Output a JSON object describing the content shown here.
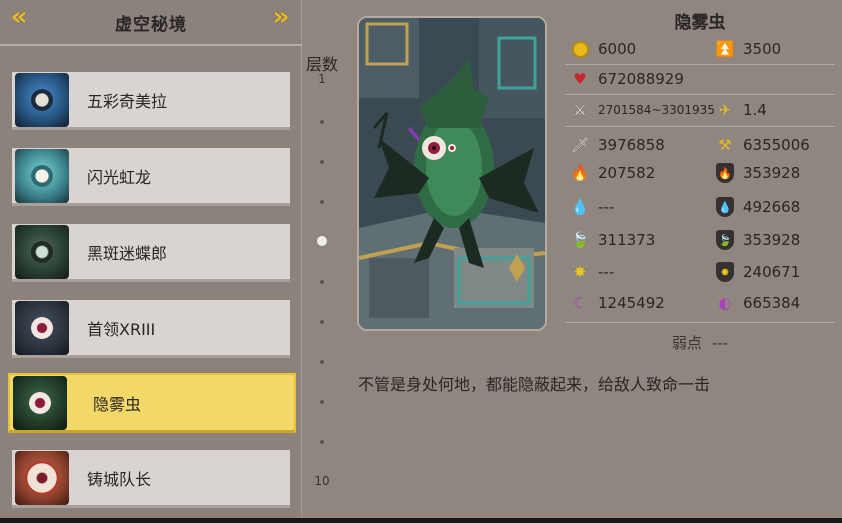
{
  "header": {
    "title": "虚空秘境",
    "prev_icon": "double-chevron-left-icon",
    "next_icon": "double-chevron-right-icon"
  },
  "monster_list": [
    {
      "name": "五彩奇美拉",
      "selected": false
    },
    {
      "name": "闪光虹龙",
      "selected": false
    },
    {
      "name": "黑斑迷蝶郎",
      "selected": false
    },
    {
      "name": "首领XRIII",
      "selected": false
    },
    {
      "name": "隐雾虫",
      "selected": true
    },
    {
      "name": "铸城队长",
      "selected": false
    }
  ],
  "floor": {
    "label": "层数",
    "first": "1",
    "last": "10",
    "current": 5
  },
  "monster": {
    "name": "隐雾虫",
    "gold": "6000",
    "exp": "3500",
    "hp": "672088929",
    "attack_range": "2701584~3301935",
    "attack_speed": "1.4",
    "physical_attack": "3976858",
    "physical_defense": "6355006",
    "fire_attack": "207582",
    "fire_defense": "353928",
    "water_attack": "---",
    "water_defense": "492668",
    "wood_attack": "311373",
    "wood_defense": "353928",
    "light_attack": "---",
    "light_defense": "240671",
    "dark_attack": "1245492",
    "dark_defense": "665384",
    "weakness_label": "弱点",
    "weakness_value": "---",
    "description": "不管是身处何地，都能隐蔽起来，给敌人致命一击"
  },
  "colors": {
    "selected_bg": "#f2d769",
    "item_bg": "#d9d4d1",
    "accent_gold": "#e8bd2c"
  }
}
